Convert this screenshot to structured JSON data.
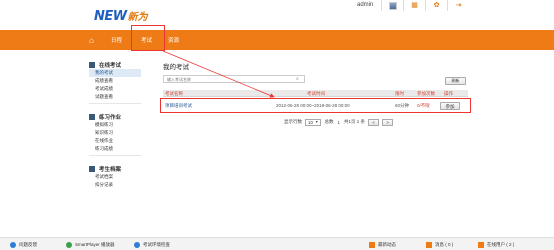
{
  "header": {
    "logo_brand": "NEW",
    "logo_cn": "新为",
    "username": "admin",
    "icons": [
      "avatar-icon",
      "grid-icon",
      "settings-icon",
      "logout-icon"
    ],
    "icon_glyphs": [
      "",
      "▦",
      "✿",
      "⇥"
    ]
  },
  "nav": {
    "home_glyph": "⌂",
    "items": [
      "日程",
      "考试",
      "资源"
    ]
  },
  "sidebar": {
    "groups": [
      {
        "title": "在线考试",
        "items": [
          "我的考试",
          "成绩查看",
          "考试成绩",
          "试题查看"
        ]
      },
      {
        "title": "练习作业",
        "items": [
          "模拟练习",
          "知识练习",
          "在线作业",
          "练习成绩"
        ]
      },
      {
        "title": "考生档案",
        "items": [
          "考试档案",
          "扣分记录"
        ]
      }
    ]
  },
  "main": {
    "title": "我的考试",
    "search_placeholder": "输入考试名称",
    "refresh_label": "刷新",
    "columns": [
      "考试名称",
      "考试时间",
      "限时",
      "参加次数",
      "操作"
    ],
    "rows": [
      {
        "name": "项目培训考试",
        "time": "2012-06-28 00:00~2018-06-28 00:00",
        "limit": "60分钟",
        "count": "0/不限",
        "action": "参加"
      }
    ],
    "pager": {
      "per_page_label": "显示行数",
      "per_page_value": "10",
      "total_label": "总数",
      "total_value": "1",
      "pages_label": "共1页 1 条",
      "prev": "<",
      "next": ">"
    }
  },
  "footer": {
    "items": [
      "问题反馈",
      "SmartPlayer 播放器",
      "考试环境检查",
      "最新动态",
      "消息 ( 0 )",
      "在线用户 ( 2 )"
    ]
  },
  "colors": {
    "nav_orange": "#ef7b16",
    "brand_blue": "#1f5fbf",
    "annotation_red": "#e33",
    "header_text_red": "#d13d2e"
  }
}
